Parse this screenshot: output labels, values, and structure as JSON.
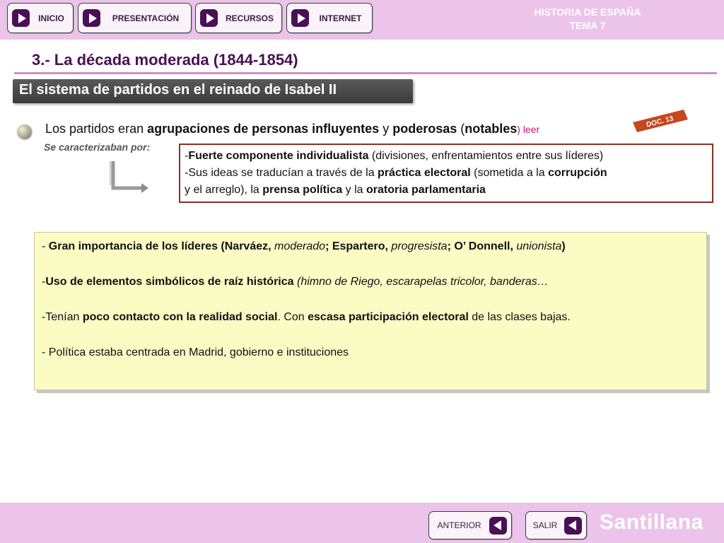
{
  "nav": {
    "inicio": "INICIO",
    "presentacion": "PRESENTACIÓN",
    "recursos": "RECURSOS",
    "internet": "INTERNET"
  },
  "header": {
    "brand_line1": "HISTORIA DE ESPAÑA",
    "brand_line2": "TEMA 7"
  },
  "heading": "3.- La década moderada (1844-1854)",
  "subtitle": "El sistema de partidos en el reinado de Isabel II",
  "intro": {
    "t1": "Los partidos eran ",
    "b1": "agrupaciones de personas influyentes",
    "t2": " y ",
    "b2": "poderosas",
    "t3": " (",
    "b3": "notables",
    "t4": ")",
    "leer": " leer"
  },
  "doc_tag": "DOC. 13",
  "characterized": "Se caracterizaban por:",
  "features": {
    "l1_pre": "-",
    "l1_b": "Fuerte componente individualista",
    "l1_post": " (divisiones, enfrentamientos entre sus líderes)",
    "l2_pre": "-Sus ideas se traducían a través de la ",
    "l2_b": "práctica electoral",
    "l2_mid": " (sometida a la ",
    "l2_b2": "corrupción",
    "l3_pre": "y el arreglo), la ",
    "l3_b": "prensa política",
    "l3_mid": " y la ",
    "l3_b2": "oratoria parlamentaria"
  },
  "panel": {
    "p1_a": "- ",
    "p1_b": "Gran importancia   de los líderes (Narváez, ",
    "p1_i1": "moderado",
    "p1_c": "; Espartero, ",
    "p1_i2": "progresista",
    "p1_d": "; O’ Donnell, ",
    "p1_i3": "unionista",
    "p1_e": ")",
    "p2_a": "-",
    "p2_b": "Uso de elementos simbólicos de raíz histórica",
    "p2_i": " (himno de Riego, escarapelas tricolor, banderas…",
    "p3_a": "-Tenían ",
    "p3_b": "poco contacto con la realidad social",
    "p3_c": ". Con ",
    "p3_d": "escasa participación electoral",
    "p3_e": " de las clases bajas.",
    "p4": "- Política estaba centrada en Madrid, gobierno e instituciones"
  },
  "footer": {
    "anterior": "ANTERIOR",
    "salir": "SALIR",
    "brand": "Santillana"
  },
  "colors": {
    "band": "#ecc4ea",
    "accent_purple": "#4a1052",
    "panel_yellow": "#fbfbc4",
    "box_border": "#8a2e25",
    "doc_tag": "#c6471e"
  },
  "icons": {
    "nav": "play-right-icon",
    "back": "play-left-icon",
    "bullet": "bullet-circle-icon",
    "arrow": "corner-arrow-icon"
  }
}
